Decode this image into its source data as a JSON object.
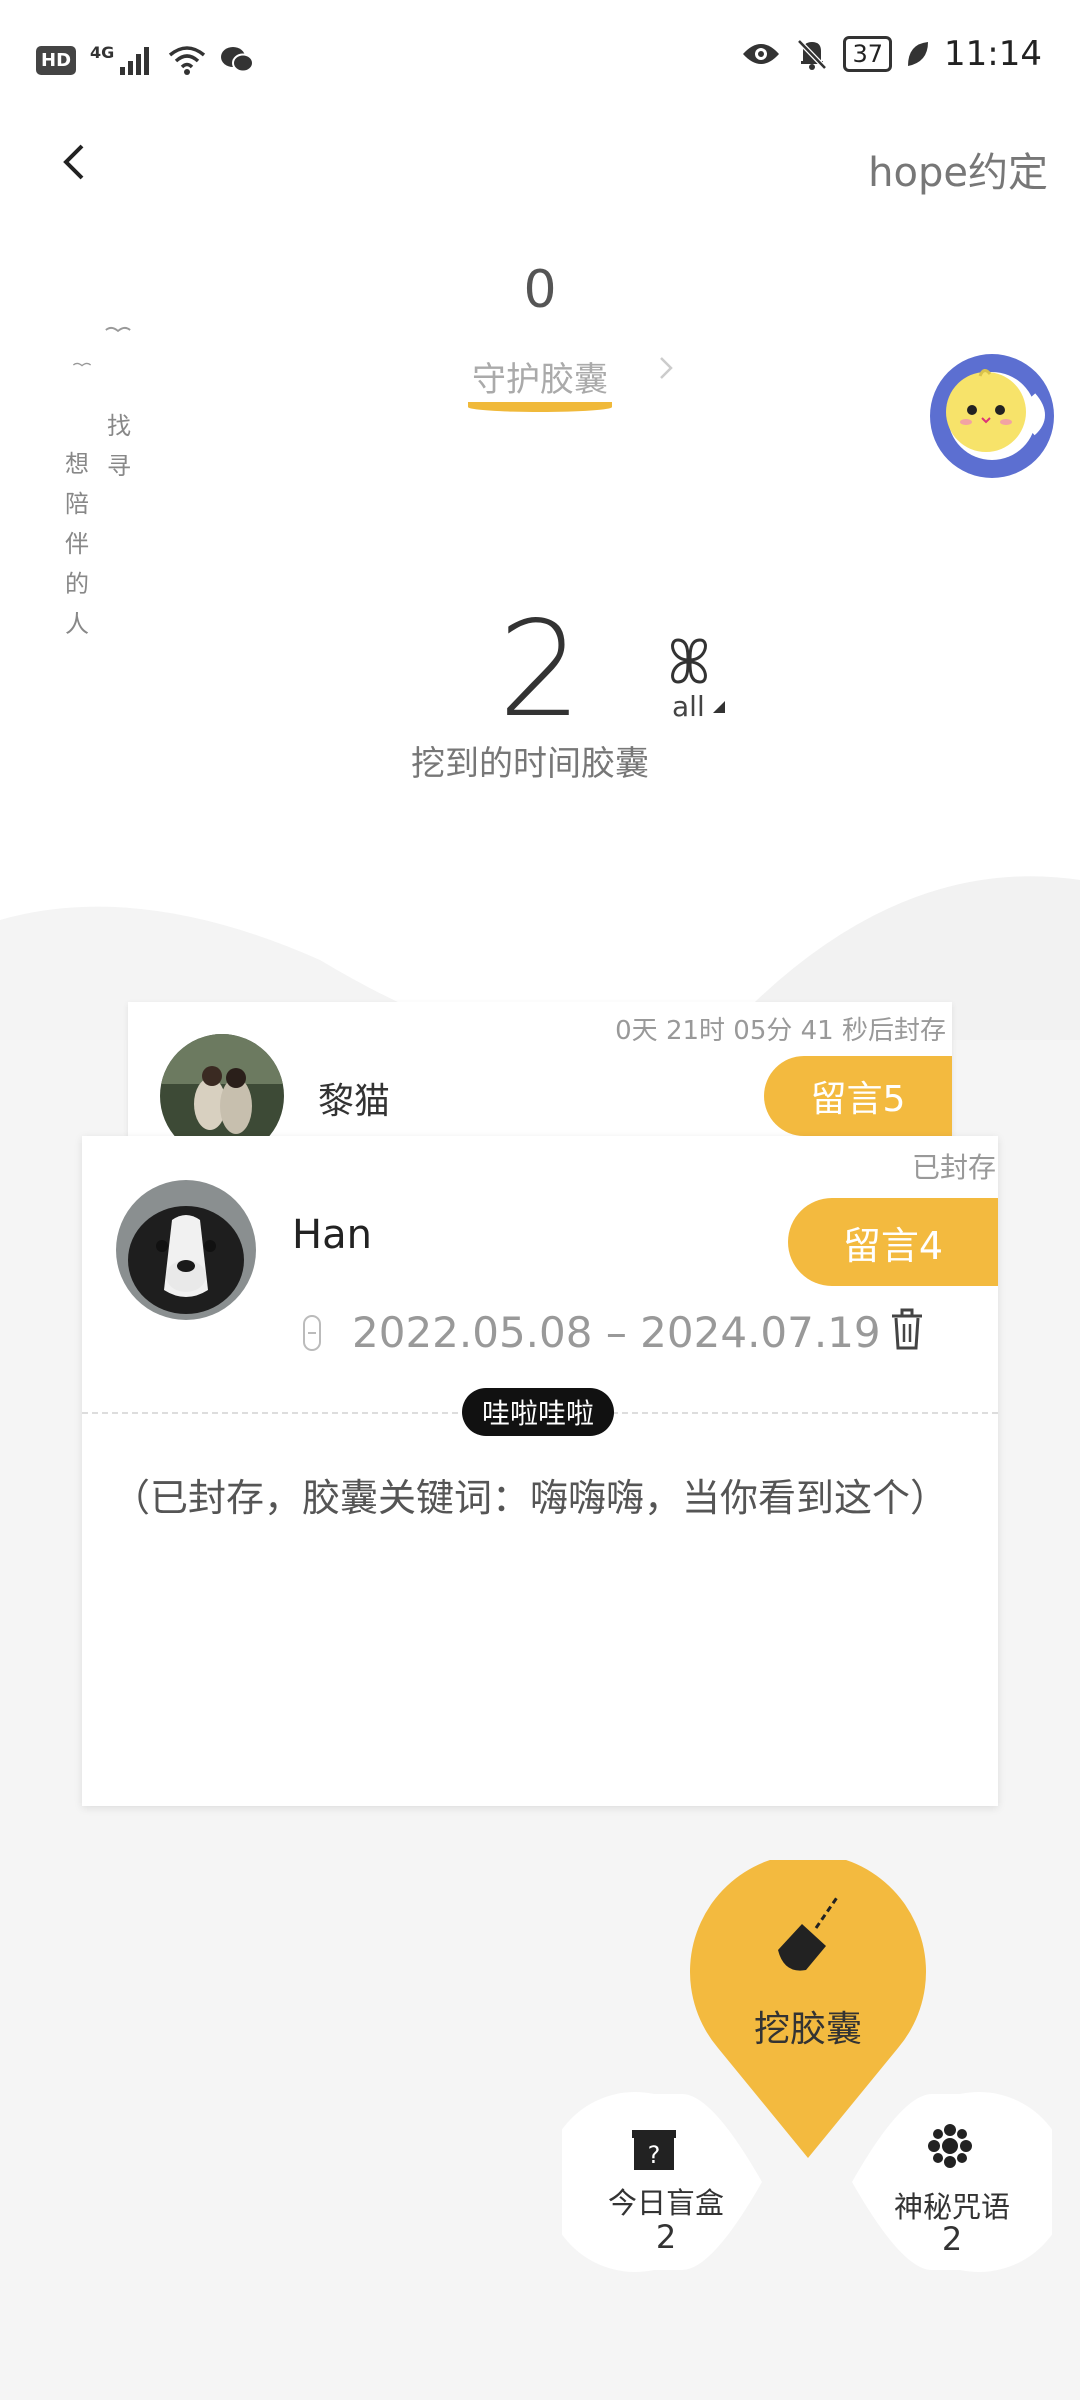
{
  "status_bar": {
    "hd": "HD",
    "network": "4G",
    "battery": "37",
    "time": "11:14"
  },
  "header": {
    "brand": "hope约定"
  },
  "guard": {
    "count": "0",
    "label": "守护胶囊"
  },
  "poem": {
    "columns": [
      "找寻",
      "想陪伴的人"
    ]
  },
  "dug": {
    "count": "2",
    "label": "挖到的时间胶囊",
    "filter": "all"
  },
  "cards": [
    {
      "timer": "0天 21时 05分 41 秒后封存",
      "name": "黎猫",
      "message_button": "留言5"
    },
    {
      "status": "已封存",
      "name": "Han",
      "message_button": "留言4",
      "date_range": "2022.05.08 – 2024.07.19",
      "tag": "哇啦哇啦",
      "note": "（已封存，胶囊关键词：嗨嗨嗨，当你看到这个）"
    }
  ],
  "actions": {
    "dig": "挖胶囊",
    "blind_box": {
      "label": "今日盲盒",
      "count": "2"
    },
    "spell": {
      "label": "神秘咒语",
      "count": "2"
    }
  },
  "colors": {
    "accent": "#f3ba3f",
    "tag_bg": "#111111",
    "hill": "#f5f5f5"
  }
}
